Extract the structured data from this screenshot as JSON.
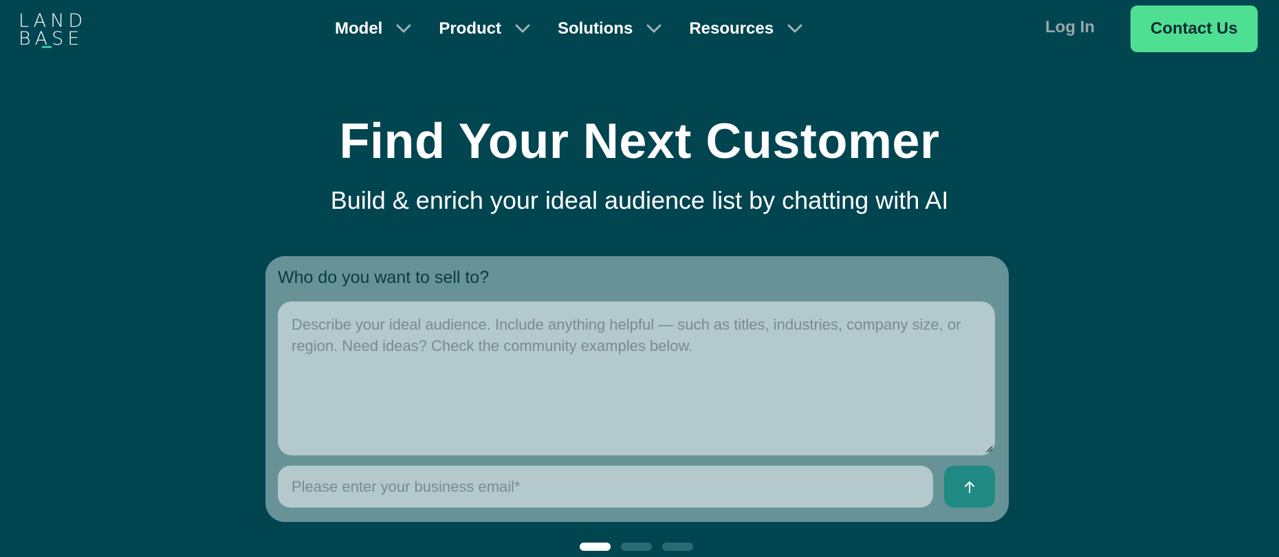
{
  "brand": {
    "logo_line1": "LAND",
    "logo_line2": "BASE",
    "accent_color": "#35c3ad"
  },
  "nav": {
    "items": [
      {
        "label": "Model",
        "icon": "chevron-down-icon"
      },
      {
        "label": "Product",
        "icon": "chevron-down-icon"
      },
      {
        "label": "Solutions",
        "icon": "chevron-down-icon"
      },
      {
        "label": "Resources",
        "icon": "chevron-down-icon"
      }
    ],
    "login_label": "Log In",
    "contact_label": "Contact Us",
    "contact_color": "#4fdf93"
  },
  "hero": {
    "title": "Find Your Next Customer",
    "subtitle": "Build & enrich your ideal audience list by chatting with AI"
  },
  "form": {
    "label": "Who do you want to sell to?",
    "audience_placeholder": "Describe your ideal audience. Include anything helpful — such as titles, industries, company size, or region. Need ideas? Check the community examples below.",
    "audience_value": "",
    "email_placeholder": "Please enter your business email*",
    "email_value": "",
    "send_icon": "arrow-up-icon",
    "send_color": "#1f8a84"
  },
  "carousel": {
    "total": 3,
    "active_index": 0
  },
  "colors": {
    "background": "#004550",
    "card": "#679397",
    "input": "#b3c9cb"
  }
}
